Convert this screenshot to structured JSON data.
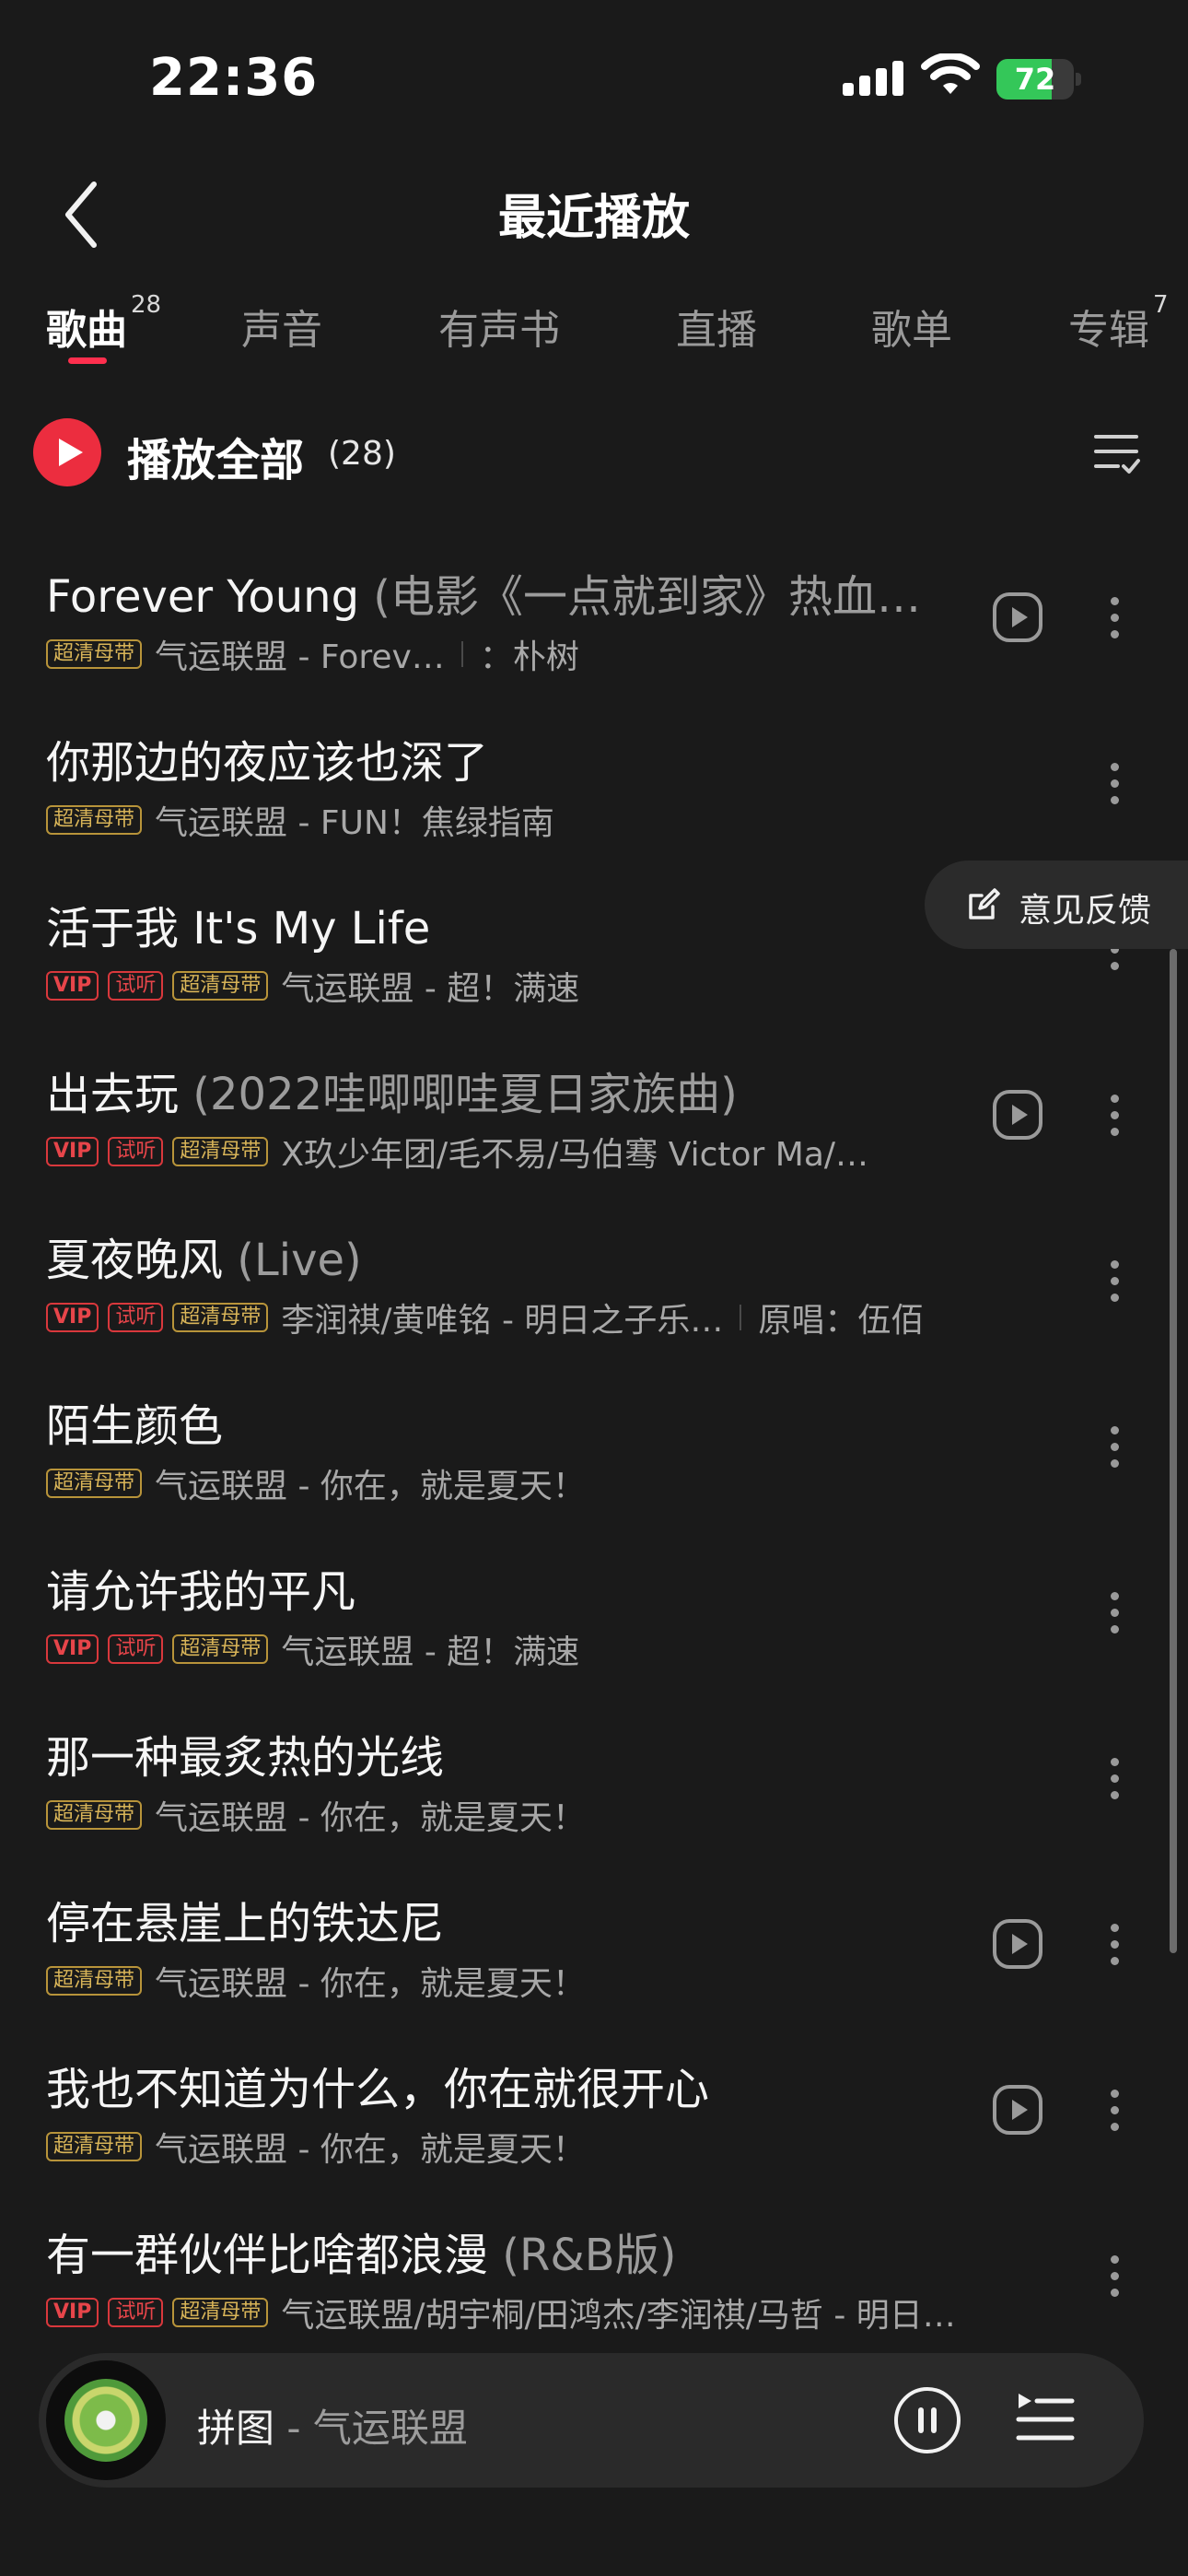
{
  "status_bar": {
    "time": "22:36",
    "battery": "72",
    "battery_level": 0.72
  },
  "header": {
    "title": "最近播放"
  },
  "tabs": [
    {
      "label": "歌曲",
      "count": "28",
      "active": true
    },
    {
      "label": "声音",
      "count": "",
      "active": false
    },
    {
      "label": "有声书",
      "count": "",
      "active": false
    },
    {
      "label": "直播",
      "count": "",
      "active": false
    },
    {
      "label": "歌单",
      "count": "",
      "active": false
    },
    {
      "label": "专辑",
      "count": "7",
      "active": false
    }
  ],
  "play_all": {
    "label": "播放全部",
    "count": "(28)"
  },
  "feedback": {
    "label": "意见反馈"
  },
  "songs": [
    {
      "title": "Forever Young",
      "subtitle": "(电影《一点就到家》热血…",
      "tags": [
        "超清母带"
      ],
      "artist": "气运联盟 - Forev…",
      "original": "：朴树",
      "mv": true
    },
    {
      "title": "你那边的夜应该也深了",
      "subtitle": "",
      "tags": [
        "超清母带"
      ],
      "artist": "气运联盟 - FUN！焦绿指南",
      "original": "",
      "mv": false
    },
    {
      "title": "活于我 It's My Life",
      "subtitle": "",
      "tags": [
        "VIP",
        "试听",
        "超清母带"
      ],
      "artist": "气运联盟 - 超！满速",
      "original": "",
      "mv": false
    },
    {
      "title": "出去玩",
      "subtitle": "(2022哇唧唧哇夏日家族曲)",
      "tags": [
        "VIP",
        "试听",
        "超清母带"
      ],
      "artist": "X玖少年团/毛不易/马伯骞 Victor Ma/…",
      "original": "",
      "mv": true
    },
    {
      "title": "夏夜晚风",
      "subtitle": "(Live)",
      "tags": [
        "VIP",
        "试听",
        "超清母带"
      ],
      "artist": "李润祺/黄唯铭 - 明日之子乐…",
      "original": "原唱：伍佰",
      "mv": false
    },
    {
      "title": "陌生颜色",
      "subtitle": "",
      "tags": [
        "超清母带"
      ],
      "artist": "气运联盟 - 你在，就是夏天！",
      "original": "",
      "mv": false
    },
    {
      "title": "请允许我的平凡",
      "subtitle": "",
      "tags": [
        "VIP",
        "试听",
        "超清母带"
      ],
      "artist": "气运联盟 - 超！满速",
      "original": "",
      "mv": false
    },
    {
      "title": "那一种最炙热的光线",
      "subtitle": "",
      "tags": [
        "超清母带"
      ],
      "artist": "气运联盟 - 你在，就是夏天！",
      "original": "",
      "mv": false
    },
    {
      "title": "停在悬崖上的铁达尼",
      "subtitle": "",
      "tags": [
        "超清母带"
      ],
      "artist": "气运联盟 - 你在，就是夏天！",
      "original": "",
      "mv": true
    },
    {
      "title": "我也不知道为什么，你在就很开心",
      "subtitle": "",
      "tags": [
        "超清母带"
      ],
      "artist": "气运联盟 - 你在，就是夏天！",
      "original": "",
      "mv": true
    },
    {
      "title": "有一群伙伴比啥都浪漫",
      "subtitle": "(R&B版)",
      "tags": [
        "VIP",
        "试听",
        "超清母带"
      ],
      "artist": "气运联盟/胡宇桐/田鸿杰/李润祺/马哲 - 明日之…",
      "original": "",
      "mv": false
    }
  ],
  "now_playing": {
    "title": "拼图",
    "artist": "气运联盟",
    "separator": " - "
  },
  "colors": {
    "accent": "#ec2d3f",
    "background": "#1a1a1a",
    "vip": "#e7454a",
    "hq": "#d8b458"
  },
  "icons": [
    "back-arrow-icon",
    "play-icon",
    "sort-icon",
    "mv-play-icon",
    "more-icon",
    "edit-icon",
    "pause-icon",
    "playlist-icon",
    "wifi-icon",
    "signal-icon",
    "battery-icon"
  ]
}
